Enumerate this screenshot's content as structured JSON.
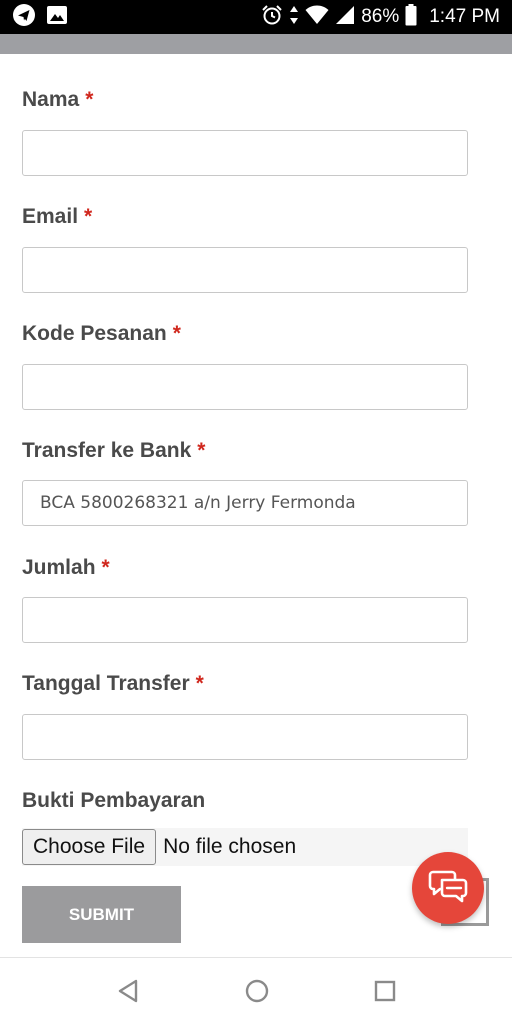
{
  "status_bar": {
    "battery": "86%",
    "time": "1:47 PM",
    "icons": [
      "telegram-icon",
      "image-icon",
      "alarm-icon",
      "data-arrows-icon",
      "wifi-icon",
      "signal-icon",
      "battery-icon"
    ]
  },
  "form": {
    "fields": [
      {
        "label": "Nama",
        "required_mark": "*",
        "value": ""
      },
      {
        "label": "Email",
        "required_mark": "*",
        "value": ""
      },
      {
        "label": "Kode Pesanan",
        "required_mark": "*",
        "value": ""
      },
      {
        "label": "Transfer ke Bank",
        "required_mark": "*",
        "value": "BCA 5800268321 a/n Jerry Fermonda"
      },
      {
        "label": "Jumlah",
        "required_mark": "*",
        "value": ""
      },
      {
        "label": "Tanggal Transfer",
        "required_mark": "*",
        "value": ""
      }
    ],
    "upload": {
      "label": "Bukti Pembayaran",
      "button_label": "Choose File",
      "status": "No file chosen"
    },
    "submit_label": "SUBMIT"
  },
  "colors": {
    "required": "#d0271d",
    "chat_button": "#e5463a",
    "submit_button": "#9b9b9d",
    "header_bar": "#9e9fa3"
  },
  "nav_bar": {
    "icons": [
      "back-icon",
      "home-icon",
      "recents-icon"
    ]
  }
}
